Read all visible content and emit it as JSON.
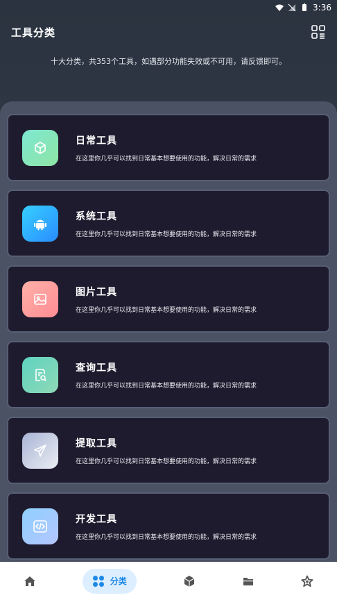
{
  "status_bar": {
    "time": "3:36"
  },
  "header": {
    "title": "工具分类"
  },
  "subtitle": "十大分类，共353个工具，如遇部分功能失效或不可用，请反馈即可。",
  "categories": [
    {
      "name": "日常工具",
      "desc": "在这里你几乎可以找到日常基本想要使用的功能，解决日常的需求"
    },
    {
      "name": "系统工具",
      "desc": "在这里你几乎可以找到日常基本想要使用的功能，解决日常的需求"
    },
    {
      "name": "图片工具",
      "desc": "在这里你几乎可以找到日常基本想要使用的功能，解决日常的需求"
    },
    {
      "name": "查询工具",
      "desc": "在这里你几乎可以找到日常基本想要使用的功能，解决日常的需求"
    },
    {
      "name": "提取工具",
      "desc": "在这里你几乎可以找到日常基本想要使用的功能，解决日常的需求"
    },
    {
      "name": "开发工具",
      "desc": "在这里你几乎可以找到日常基本想要使用的功能，解决日常的需求"
    }
  ],
  "nav": {
    "active_label": "分类"
  },
  "colors": {
    "accent": "#1e88e5",
    "card_bg": "#1f1b2e",
    "panel_bg": "#4b5264"
  }
}
